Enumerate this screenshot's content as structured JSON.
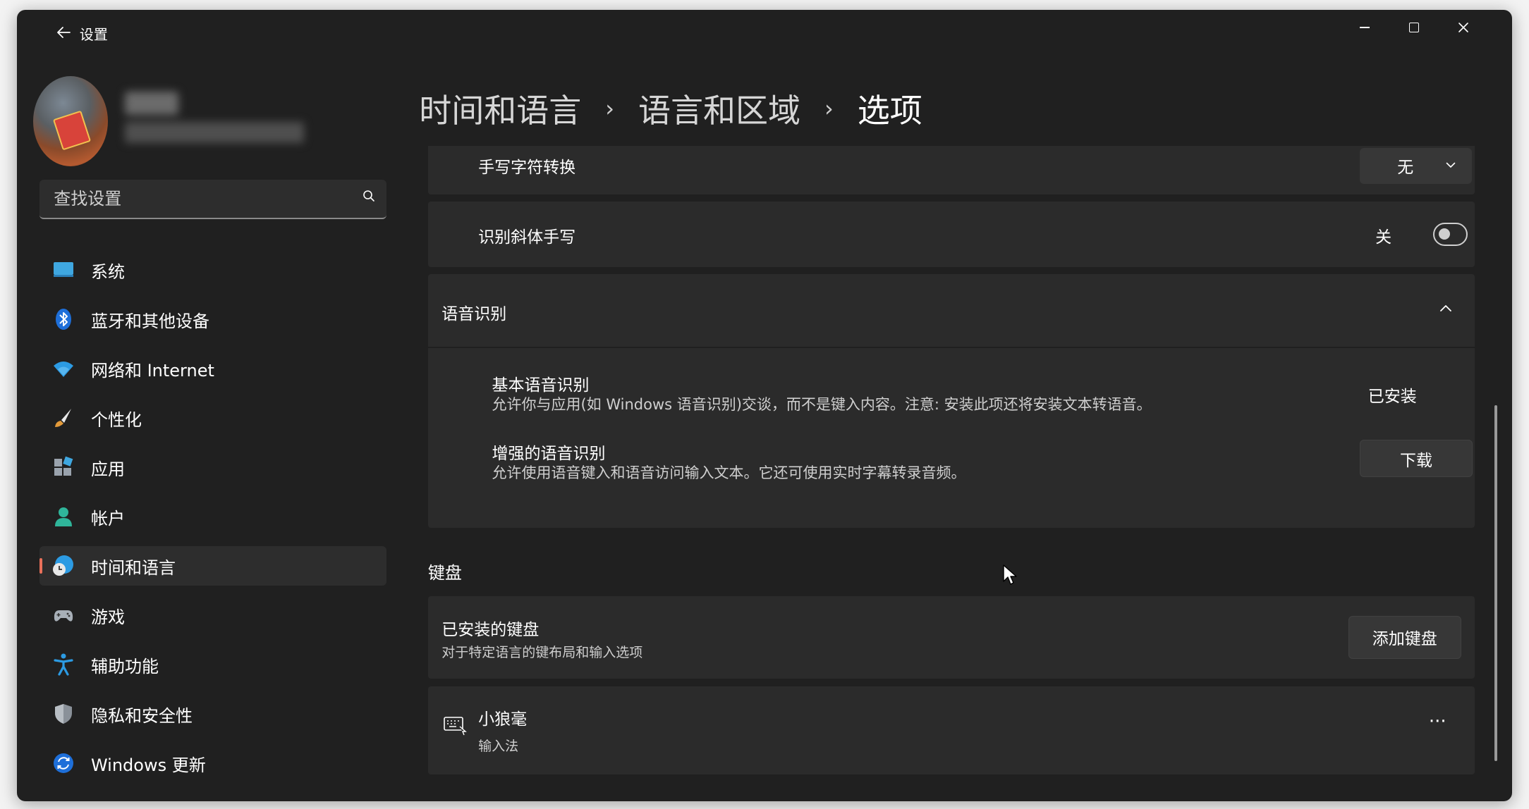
{
  "window": {
    "title": "设置",
    "controls": {
      "minimize": "minimize-icon",
      "maximize": "maximize-icon",
      "close": "close-icon"
    }
  },
  "sidebar": {
    "search": {
      "placeholder": "查找设置"
    },
    "items": [
      {
        "label": "系统",
        "icon": "system-monitor-icon"
      },
      {
        "label": "蓝牙和其他设备",
        "icon": "bluetooth-icon"
      },
      {
        "label": "网络和 Internet",
        "icon": "wifi-icon"
      },
      {
        "label": "个性化",
        "icon": "paintbrush-icon"
      },
      {
        "label": "应用",
        "icon": "apps-icon"
      },
      {
        "label": "帐户",
        "icon": "account-icon"
      },
      {
        "label": "时间和语言",
        "icon": "time-language-icon",
        "active": true
      },
      {
        "label": "游戏",
        "icon": "gamepad-icon"
      },
      {
        "label": "辅助功能",
        "icon": "accessibility-icon"
      },
      {
        "label": "隐私和安全性",
        "icon": "shield-icon"
      },
      {
        "label": "Windows 更新",
        "icon": "windows-update-icon"
      }
    ]
  },
  "breadcrumb": {
    "items": [
      "时间和语言",
      "语言和区域",
      "选项"
    ],
    "separator": "›"
  },
  "handwriting": {
    "char_conversion": {
      "label": "手写字符转换",
      "value": "无"
    },
    "italic": {
      "label": "识别斜体手写",
      "state_label": "关",
      "on": false
    }
  },
  "speech": {
    "title": "语音识别",
    "basic": {
      "title": "基本语音识别",
      "desc": "允许你与应用(如 Windows 语音识别)交谈，而不是键入内容。注意: 安装此项还将安装文本转语音。",
      "status": "已安装"
    },
    "enhanced": {
      "title": "增强的语音识别",
      "desc": "允许使用语音键入和语音访问输入文本。它还可使用实时字幕转录音频。",
      "button": "下载"
    }
  },
  "keyboard": {
    "section_title": "键盘",
    "installed": {
      "title": "已安装的键盘",
      "desc": "对于特定语言的键布局和输入选项",
      "button": "添加键盘"
    },
    "items": [
      {
        "name": "小狼毫",
        "type": "输入法",
        "icon": "keyboard-icon",
        "more": "···"
      }
    ]
  },
  "colors": {
    "accent": "#e8705a",
    "window_bg": "#202020",
    "card_bg": "#2b2b2b"
  }
}
